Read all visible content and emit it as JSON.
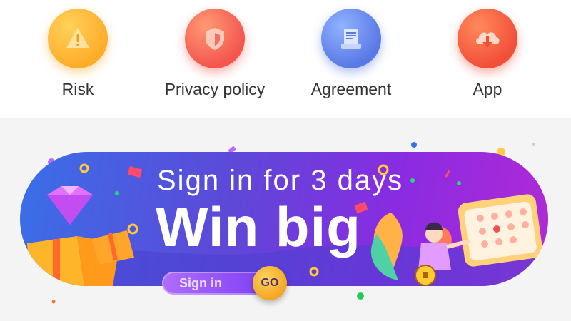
{
  "nav": {
    "items": [
      {
        "label": "Risk",
        "icon": "warning-icon"
      },
      {
        "label": "Privacy policy",
        "icon": "shield-icon"
      },
      {
        "label": "Agreement",
        "icon": "document-icon"
      },
      {
        "label": "App",
        "icon": "cloud-download-icon"
      }
    ]
  },
  "banner": {
    "headline": "Sign in for 3 days",
    "subheadline": "Win big",
    "signin_label": "Sign in",
    "go_label": "GO"
  },
  "colors": {
    "risk": "#ffac2a",
    "privacy": "#f4564e",
    "agreement": "#5a79e6",
    "app": "#f24f38",
    "banner_start": "#3a6fe8",
    "banner_end": "#b12ad6",
    "go_button": "#f4a521"
  }
}
